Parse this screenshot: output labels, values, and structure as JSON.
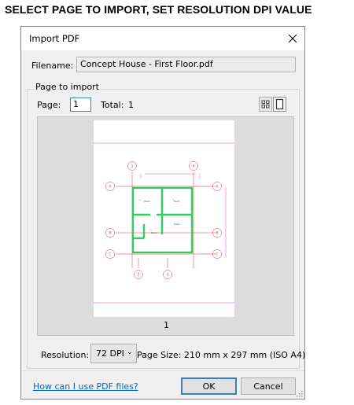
{
  "caption": "SELECT PAGE TO IMPORT, SET RESOLUTION DPI VALUE",
  "dialog": {
    "title": "Import PDF",
    "filename_label": "Filename:",
    "filename_value": "Concept House - First Floor.pdf",
    "group_title": "Page to import",
    "page_label": "Page:",
    "page_value": "1",
    "total_label": "Total:",
    "total_value": "1",
    "preview_page_number": "1",
    "resolution_label": "Resolution:",
    "resolution_value": "72 DPI",
    "page_size": "Page Size: 210 mm x 297 mm (ISO A4)",
    "help_link": "How can I use PDF files?",
    "ok_label": "OK",
    "cancel_label": "Cancel"
  },
  "drawing": {
    "grid_labels": [
      "1",
      "4",
      "A",
      "A",
      "B",
      "B",
      "C",
      "C",
      "2",
      "3"
    ],
    "room_labels": [
      "Room",
      "Room",
      "Room",
      "Room"
    ]
  },
  "icons": {
    "close": "close-icon",
    "thumbnails": "thumbnails-view-icon",
    "single_page": "single-page-view-icon",
    "chevron": "chevron-down-icon",
    "resize_grip": "resize-grip-icon"
  },
  "colors": {
    "link": "#0066cc",
    "focus_border": "#3c7fb1",
    "dialog_bg": "#f0f0f0",
    "wall_green": "#33cc66",
    "grid_red": "#e0333c",
    "guide_magenta": "#e040e0"
  }
}
